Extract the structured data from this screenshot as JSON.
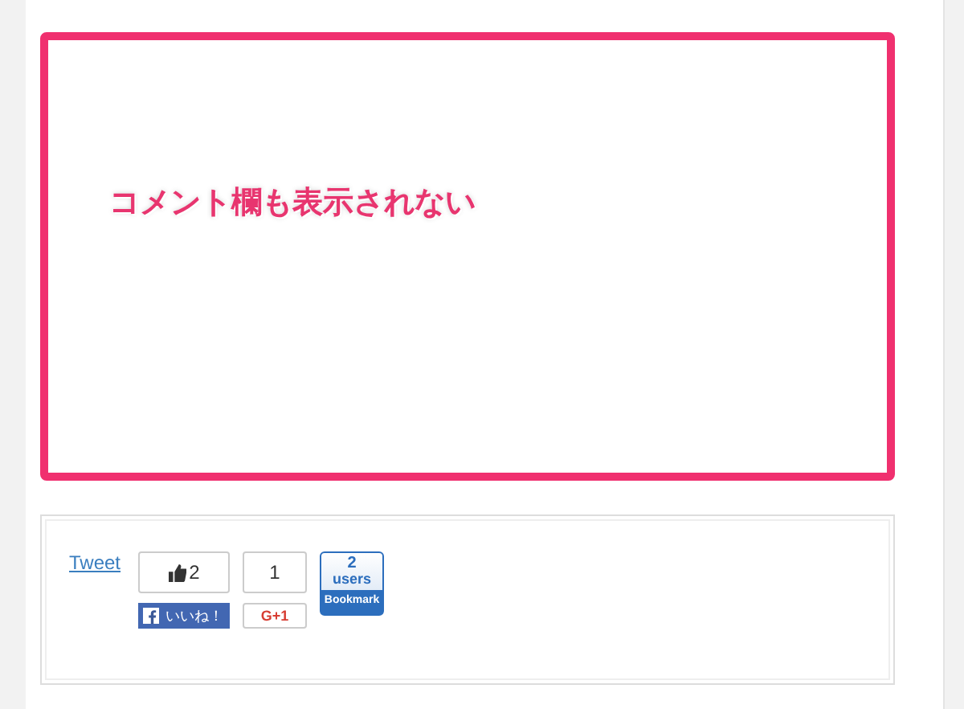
{
  "annotation": {
    "text": "コメント欄も表示されない"
  },
  "share": {
    "tweet": "Tweet",
    "facebook": {
      "count": "2",
      "button": "いいね！"
    },
    "google": {
      "count": "1",
      "button": "G+1"
    },
    "hatena": {
      "count": "2",
      "unit": "users",
      "button": "Bookmark"
    }
  }
}
